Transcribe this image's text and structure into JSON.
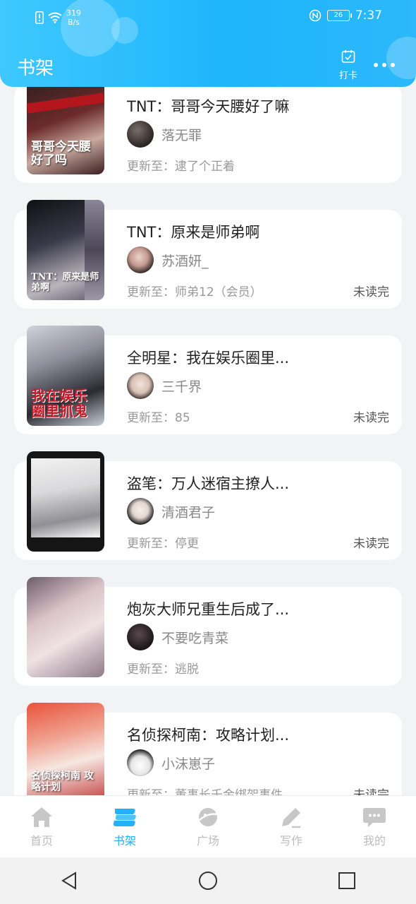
{
  "status_bar": {
    "net_speed_value": "319",
    "net_speed_unit": "B/s",
    "battery": "26",
    "time": "7:37"
  },
  "header": {
    "title": "书架",
    "checkin_label": "打卡"
  },
  "books": [
    {
      "title": "TNT：哥哥今天腰好了嘛",
      "author": "落无罪",
      "update": "更新至：逮了个正着",
      "status": "",
      "cover_text": "哥哥今天腰好了吗"
    },
    {
      "title": "TNT：原来是师弟啊",
      "author": "苏酒妍_",
      "update": "更新至：师弟12（会员）",
      "status": "未读完",
      "cover_text": "TNT：原来是师弟啊"
    },
    {
      "title": "全明星：我在娱乐圈里...",
      "author": "三千界",
      "update": "更新至：85",
      "status": "未读完",
      "cover_text": "我在娱乐圈里抓鬼"
    },
    {
      "title": "盗笔：万人迷宿主撩人...",
      "author": "清酒君子",
      "update": "更新至：停更",
      "status": "未读完",
      "cover_text": ""
    },
    {
      "title": "炮灰大师兄重生后成了...",
      "author": "不要吃青菜",
      "update": "更新至：逃脱",
      "status": "",
      "cover_text": ""
    },
    {
      "title": "名侦探柯南：攻略计划...",
      "author": "小沫崽子",
      "update": "更新至：董事长千金绑架事件",
      "status": "未读完",
      "cover_text": "名侦探柯南 攻略计划"
    }
  ],
  "tabs": [
    {
      "label": "首页",
      "icon": "home-icon"
    },
    {
      "label": "书架",
      "icon": "bookshelf-icon"
    },
    {
      "label": "广场",
      "icon": "planet-icon"
    },
    {
      "label": "写作",
      "icon": "pen-icon"
    },
    {
      "label": "我的",
      "icon": "chat-bubble-icon"
    }
  ],
  "colors": {
    "accent": "#23b1f7",
    "header": "#1eb5fb"
  }
}
